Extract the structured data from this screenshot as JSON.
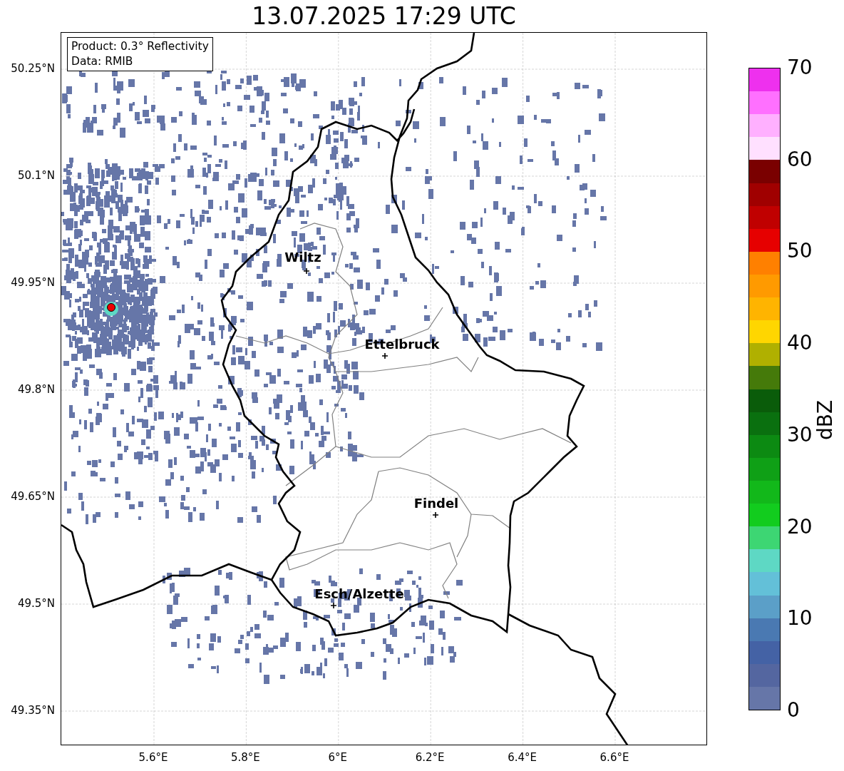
{
  "title": "13.07.2025 17:29 UTC",
  "info_box": [
    "Product: 0.3° Reflectivity",
    "Data: RMIB"
  ],
  "map": {
    "y_ticks": [
      "50.25°N",
      "50.1°N",
      "49.95°N",
      "49.8°N",
      "49.65°N",
      "49.5°N",
      "49.35°N"
    ],
    "x_ticks": [
      "5.6°E",
      "5.8°E",
      "6°E",
      "6.2°E",
      "6.4°E",
      "6.6°E"
    ],
    "cities": [
      {
        "name": "Wiltz"
      },
      {
        "name": "Ettelbruck"
      },
      {
        "name": "Findel"
      },
      {
        "name": "Esch/Alzette"
      }
    ]
  },
  "colorbar": {
    "label": "dBZ",
    "ticks": [
      "70",
      "60",
      "50",
      "40",
      "30",
      "20",
      "10",
      "0"
    ],
    "bins": [
      {
        "color": "#ee30ee"
      },
      {
        "color": "#ff70ff"
      },
      {
        "color": "#ffb0ff"
      },
      {
        "color": "#ffe0ff"
      },
      {
        "color": "#7a0000"
      },
      {
        "color": "#a00000"
      },
      {
        "color": "#c00000"
      },
      {
        "color": "#e60000"
      },
      {
        "color": "#ff8000"
      },
      {
        "color": "#ff9a00"
      },
      {
        "color": "#ffb400"
      },
      {
        "color": "#ffd600"
      },
      {
        "color": "#b0b000"
      },
      {
        "color": "#457a0a"
      },
      {
        "color": "#0a5c0a"
      },
      {
        "color": "#0a700f"
      },
      {
        "color": "#0c8a12"
      },
      {
        "color": "#0fa016"
      },
      {
        "color": "#12b81a"
      },
      {
        "color": "#12cc1e"
      },
      {
        "color": "#3dd673"
      },
      {
        "color": "#5ed8c4"
      },
      {
        "color": "#63c0d8"
      },
      {
        "color": "#5b9fc8"
      },
      {
        "color": "#4a79b2"
      },
      {
        "color": "#4462a5"
      },
      {
        "color": "#5466a0"
      },
      {
        "color": "#6676a8"
      }
    ]
  }
}
